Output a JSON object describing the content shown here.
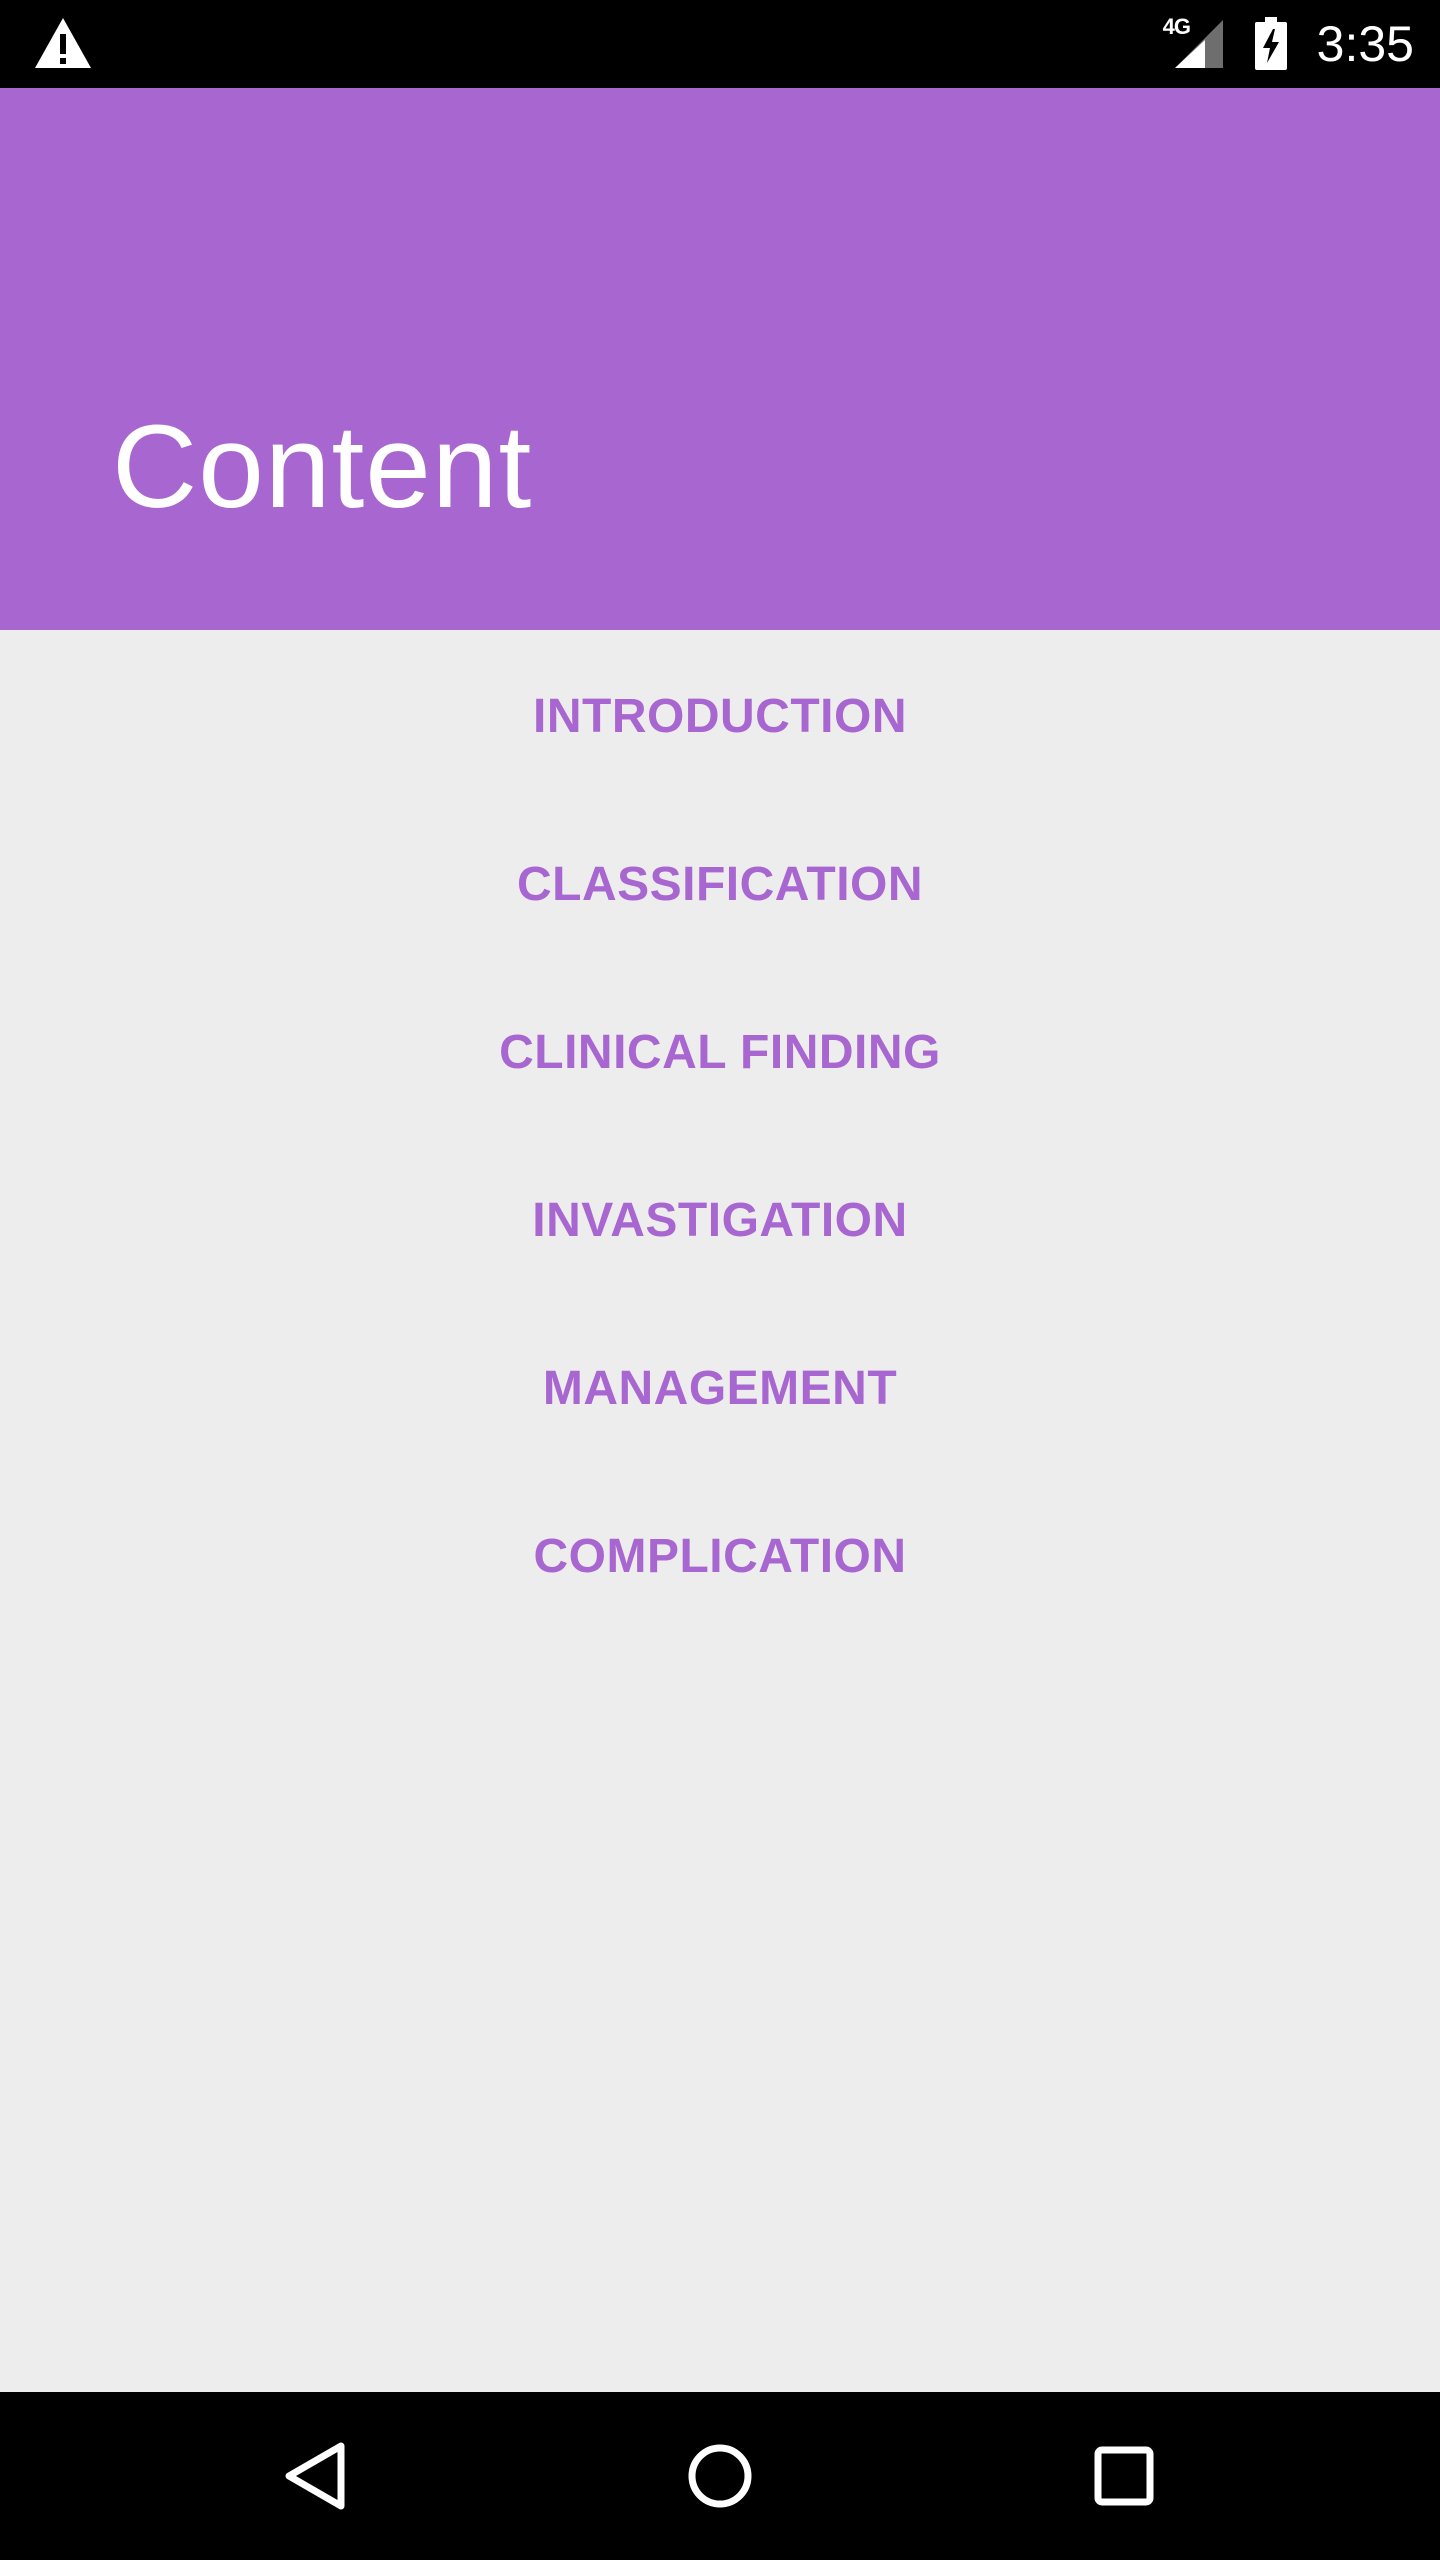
{
  "status_bar": {
    "network_label": "4G",
    "time": "3:35",
    "icons": [
      "warning-icon",
      "signal-icon",
      "battery-charging-icon"
    ]
  },
  "app_bar": {
    "title": "Content",
    "color": "#a867d0"
  },
  "menu": {
    "items": [
      {
        "label": "INTRODUCTION"
      },
      {
        "label": "CLASSIFICATION"
      },
      {
        "label": "CLINICAL FINDING"
      },
      {
        "label": "INVASTIGATION"
      },
      {
        "label": "MANAGEMENT"
      },
      {
        "label": "COMPLICATION"
      }
    ],
    "text_color": "#a867d0"
  },
  "nav_bar": {
    "buttons": [
      "back-icon",
      "home-icon",
      "recents-icon"
    ]
  },
  "colors": {
    "accent": "#a867d0",
    "background": "#eeedee",
    "system_bars": "#000000"
  }
}
